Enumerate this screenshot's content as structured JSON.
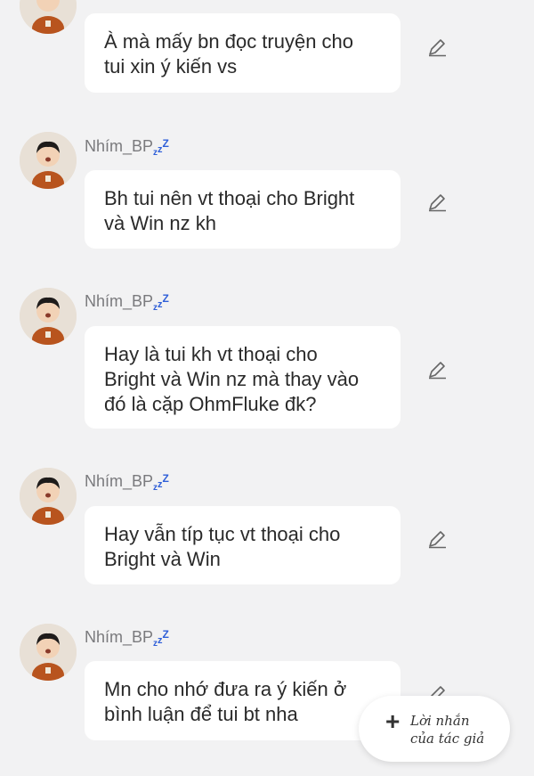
{
  "messages": [
    {
      "name": "",
      "text_lines": [
        "À mà mấy bn đọc truyện cho",
        "tui xin ý kiến vs"
      ]
    },
    {
      "name": "Nhím_BP",
      "text_lines": [
        "Bh tui nên vt thoại cho  Bright",
        "và Win nz kh"
      ]
    },
    {
      "name": "Nhím_BP",
      "text_lines": [
        "Hay là tui kh vt thoại cho",
        "Bright và Win nz mà thay vào",
        "đó là cặp OhmFluke đk?"
      ]
    },
    {
      "name": "Nhím_BP",
      "text_lines": [
        "Hay vẫn típ tục vt thoại cho",
        "Bright và Win"
      ]
    },
    {
      "name": "Nhím_BP",
      "text_lines": [
        "Mn cho nhớ đưa ra ý kiến ở",
        "bình luận để tui bt nha"
      ]
    }
  ],
  "sleep_badge": [
    "z",
    "z",
    "Z"
  ],
  "author_note_button": {
    "line1": "Lời nhắn",
    "line2": "của tác giả",
    "icon": "plus-icon"
  },
  "icons": {
    "edit": "pencil-icon",
    "avatar": "user-avatar"
  },
  "colors": {
    "background": "#f2f2f3",
    "bubble": "#ffffff",
    "name": "#7a7a7d",
    "zzz": "#2f5fd8"
  }
}
